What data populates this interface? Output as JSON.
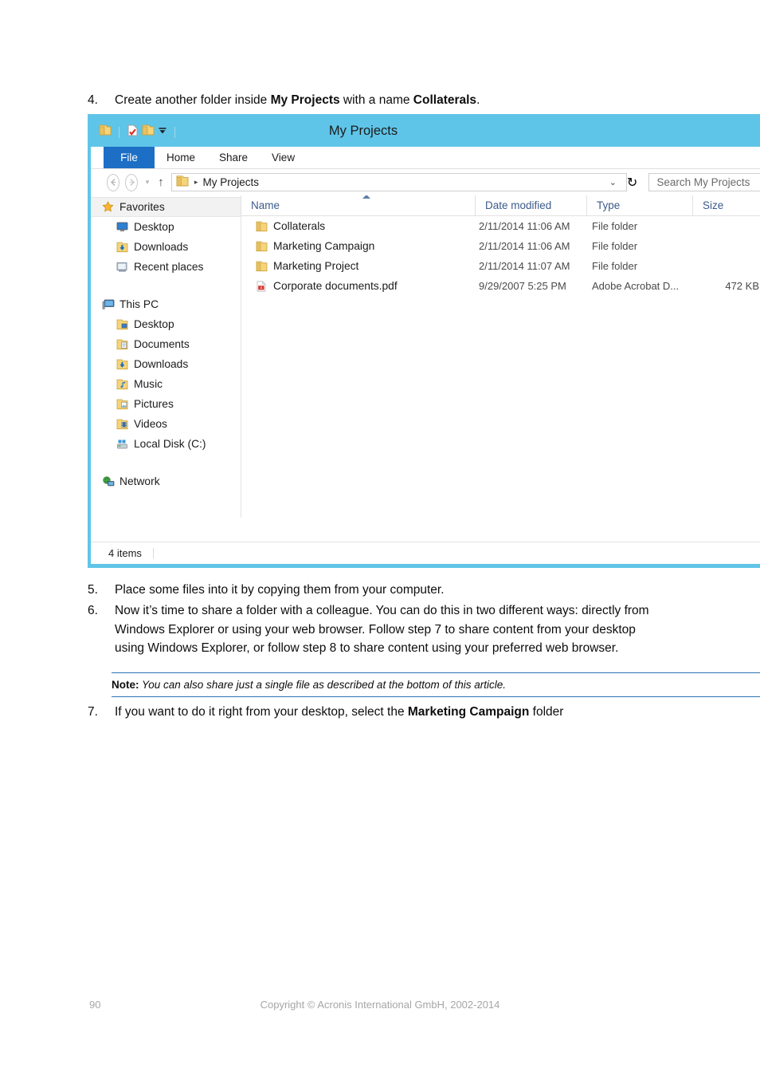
{
  "document": {
    "steps": [
      {
        "num": "4.",
        "parts": [
          {
            "t": "Create another folder inside ",
            "b": false
          },
          {
            "t": "My Projects",
            "b": true
          },
          {
            "t": " with a name ",
            "b": false
          },
          {
            "t": "Collaterals",
            "b": true
          },
          {
            "t": ".",
            "b": false
          }
        ]
      },
      {
        "num": "5.",
        "parts": [
          {
            "t": "Place some files into it by copying them from your computer.",
            "b": false
          }
        ]
      },
      {
        "num": "6.",
        "parts": [
          {
            "t": "Now it’s time to share a folder with a colleague. You can do this in two different ways: directly from Windows Explorer or using your web browser. Follow step 7 to share content from your desktop using Windows Explorer, or follow step 8 to share content using your preferred web browser.",
            "b": false
          }
        ]
      },
      {
        "num": "7.",
        "parts": [
          {
            "t": "If you want to do it right from your desktop, select the ",
            "b": false
          },
          {
            "t": "Marketing Campaign",
            "b": true
          },
          {
            "t": " folder",
            "b": false
          }
        ]
      }
    ],
    "note": {
      "label": "Note:",
      "text": " You can also share just a single file as described at the bottom of this article.",
      "rule_color": "#2e74b5"
    },
    "footer": {
      "page_number": "90",
      "copyright": "Copyright © Acronis International GmbH, 2002-2014"
    }
  },
  "explorer": {
    "accent_color": "#5fc5e8",
    "file_tab_color": "#1c6fc4",
    "title": "My Projects",
    "quick_access": [
      {
        "name": "folder-icon",
        "label": "Folder"
      },
      {
        "name": "properties-icon",
        "label": "Properties"
      },
      {
        "name": "new-folder-icon",
        "label": "New folder"
      },
      {
        "name": "chevron-down-icon",
        "label": "Customize Quick Access Toolbar"
      }
    ],
    "tabs": [
      {
        "label": "File",
        "active": true
      },
      {
        "label": "Home",
        "active": false
      },
      {
        "label": "Share",
        "active": false
      },
      {
        "label": "View",
        "active": false
      }
    ],
    "nav": {
      "back": "←",
      "forward": "→",
      "recent": "▾",
      "up": "↑"
    },
    "address": {
      "crumb_separator": "▸",
      "path": "My Projects",
      "dropdown": "⌄",
      "refresh": "↻"
    },
    "search": {
      "placeholder": "Search My Projects",
      "value": "Search My Projects"
    },
    "navpane": [
      {
        "label": "Favorites",
        "icon": "star-icon",
        "level": 0,
        "selected": true
      },
      {
        "label": "Desktop",
        "icon": "monitor-icon",
        "level": 1,
        "selected": false
      },
      {
        "label": "Downloads",
        "icon": "downloads-icon",
        "level": 1,
        "selected": false
      },
      {
        "label": "Recent places",
        "icon": "recent-places-icon",
        "level": 1,
        "selected": false
      },
      {
        "label": "__GAP__",
        "icon": "",
        "level": 0,
        "selected": false
      },
      {
        "label": "This PC",
        "icon": "this-pc-icon",
        "level": 0,
        "selected": false
      },
      {
        "label": "Desktop",
        "icon": "desktop-folder-icon",
        "level": 1,
        "selected": false
      },
      {
        "label": "Documents",
        "icon": "documents-icon",
        "level": 1,
        "selected": false
      },
      {
        "label": "Downloads",
        "icon": "downloads-icon",
        "level": 1,
        "selected": false
      },
      {
        "label": "Music",
        "icon": "music-icon",
        "level": 1,
        "selected": false
      },
      {
        "label": "Pictures",
        "icon": "pictures-icon",
        "level": 1,
        "selected": false
      },
      {
        "label": "Videos",
        "icon": "videos-icon",
        "level": 1,
        "selected": false
      },
      {
        "label": "Local Disk (C:)",
        "icon": "drive-icon",
        "level": 1,
        "selected": false
      },
      {
        "label": "__GAP__",
        "icon": "",
        "level": 0,
        "selected": false
      },
      {
        "label": "Network",
        "icon": "network-icon",
        "level": 0,
        "selected": false
      }
    ],
    "columns": [
      {
        "label": "Name",
        "key": "name",
        "sorted": true
      },
      {
        "label": "Date modified",
        "key": "date",
        "sorted": false
      },
      {
        "label": "Type",
        "key": "type",
        "sorted": false
      },
      {
        "label": "Size",
        "key": "size",
        "sorted": false
      }
    ],
    "files": [
      {
        "name": "Collaterals",
        "date": "2/11/2014 11:06 AM",
        "type": "File folder",
        "size": "",
        "icon": "folder-icon"
      },
      {
        "name": "Marketing Campaign",
        "date": "2/11/2014 11:06 AM",
        "type": "File folder",
        "size": "",
        "icon": "folder-icon"
      },
      {
        "name": "Marketing Project",
        "date": "2/11/2014 11:07 AM",
        "type": "File folder",
        "size": "",
        "icon": "folder-icon"
      },
      {
        "name": "Corporate documents.pdf",
        "date": "9/29/2007 5:25 PM",
        "type": "Adobe Acrobat D...",
        "size": "472 KB",
        "icon": "pdf-icon"
      }
    ],
    "statusbar": {
      "item_count": "4 items"
    }
  }
}
